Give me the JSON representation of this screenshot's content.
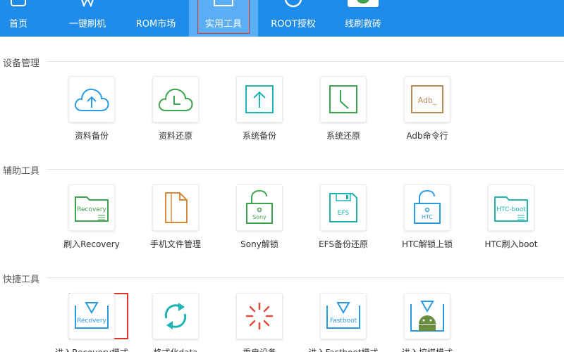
{
  "nav": {
    "items": [
      {
        "label": "首页"
      },
      {
        "label": "一键刷机"
      },
      {
        "label": "ROM市场"
      },
      {
        "label": "实用工具",
        "active": true
      },
      {
        "label": "ROOT授权"
      },
      {
        "label": "线刷救砖"
      }
    ]
  },
  "sections": [
    {
      "title": "设备管理",
      "tools": [
        {
          "label": "资料备份",
          "icon": "cloud-upload-icon"
        },
        {
          "label": "资料还原",
          "icon": "cloud-clock-icon"
        },
        {
          "label": "系统备份",
          "icon": "box-upload-icon"
        },
        {
          "label": "系统还原",
          "icon": "box-clock-icon"
        },
        {
          "label": "Adb命令行",
          "icon": "adb-terminal-icon",
          "icon_text": "Adb_"
        }
      ]
    },
    {
      "title": "辅助工具",
      "tools": [
        {
          "label": "刷入Recovery",
          "icon": "recovery-folder-icon",
          "icon_text": "Recovery"
        },
        {
          "label": "手机文件管理",
          "icon": "file-icon"
        },
        {
          "label": "Sony解锁",
          "icon": "sony-lock-icon",
          "icon_text": "Sony"
        },
        {
          "label": "EFS备份还原",
          "icon": "efs-disk-icon",
          "icon_text": "EFS"
        },
        {
          "label": "HTC解锁上锁",
          "icon": "htc-lock-icon",
          "icon_text": "HTC"
        },
        {
          "label": "HTC刷入boot",
          "icon": "htc-boot-folder-icon",
          "icon_text": "HTC-boot"
        }
      ]
    },
    {
      "title": "快捷工具",
      "tools": [
        {
          "label": "进入Recovery模式",
          "icon": "recovery-mode-icon",
          "icon_text": "Recovery",
          "highlighted": true
        },
        {
          "label": "格式化data",
          "icon": "refresh-icon"
        },
        {
          "label": "重启设备",
          "icon": "loading-spinner-icon"
        },
        {
          "label": "进入Fastboot模式",
          "icon": "fastboot-mode-icon",
          "icon_text": "Fastboot"
        },
        {
          "label": "进入挖煤模式",
          "icon": "android-download-icon"
        }
      ]
    }
  ],
  "colors": {
    "nav_bg": "#1e8ce8",
    "nav_active_bg": "#5aaef5",
    "highlight_red": "#e1322d",
    "icon_blue": "#2a9be0",
    "icon_green": "#3fa34d",
    "icon_teal": "#1fb3b3",
    "icon_brown": "#b98b5b",
    "icon_orange": "#d9893c",
    "icon_red": "#e04a3f",
    "android_green": "#6b8f3e"
  }
}
